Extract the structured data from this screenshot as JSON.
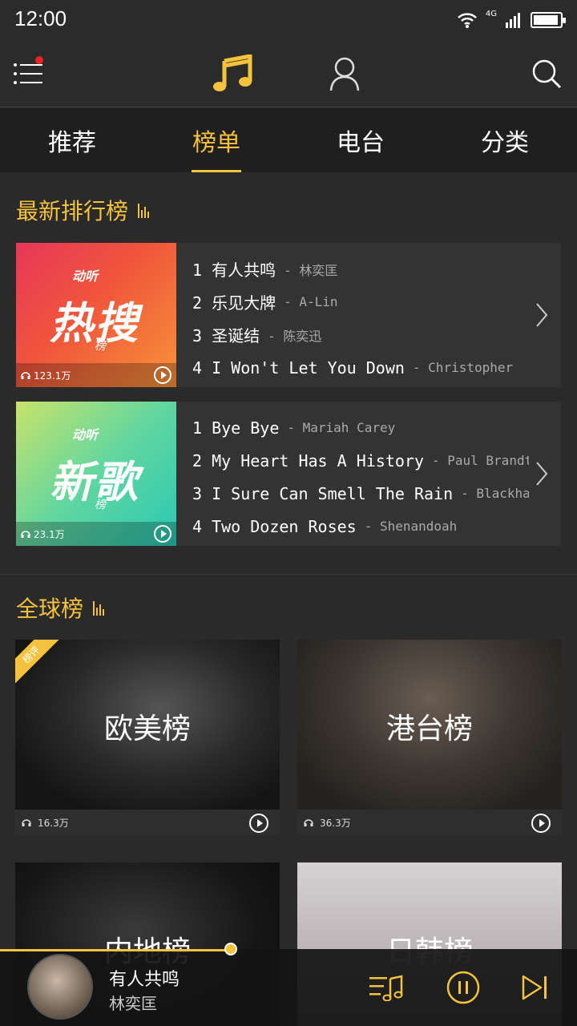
{
  "status": {
    "time": "12:00",
    "network": "4G"
  },
  "top_nav": {
    "menu_icon": "menu-icon",
    "music_icon": "music-note-icon",
    "user_icon": "user-icon",
    "search_icon": "search-icon",
    "accent": "#f5c33b"
  },
  "tabs": [
    {
      "label": "推荐",
      "active": false
    },
    {
      "label": "榜单",
      "active": true
    },
    {
      "label": "电台",
      "active": false
    },
    {
      "label": "分类",
      "active": false
    }
  ],
  "latest": {
    "title": "最新排行榜",
    "charts": [
      {
        "cover_small": "动听",
        "cover_big": "热搜",
        "cover_sub": "榜",
        "plays": "123.1万",
        "songs": [
          {
            "song": "1 有人共鸣",
            "artist": "- 林奕匡"
          },
          {
            "song": "2 乐见大牌",
            "artist": "- A-Lin"
          },
          {
            "song": "3 圣诞结",
            "artist": "- 陈奕迅"
          },
          {
            "song": "4 I Won't Let You Down",
            "artist": "- Christopher"
          }
        ]
      },
      {
        "cover_small": "动听",
        "cover_big": "新歌",
        "cover_sub": "榜",
        "plays": "23.1万",
        "songs": [
          {
            "song": "1 Bye Bye",
            "artist": "- Mariah Carey"
          },
          {
            "song": "2 My Heart Has A History",
            "artist": "- Paul Brandt"
          },
          {
            "song": "3 I Sure Can Smell The Rain",
            "artist": "- Blackhawk"
          },
          {
            "song": "4 Two Dozen Roses",
            "artist": "- Shenandoah"
          }
        ]
      }
    ]
  },
  "global": {
    "title": "全球榜",
    "charts": [
      {
        "label": "欧美榜",
        "plays": "16.3万",
        "ribbon": "榜评"
      },
      {
        "label": "港台榜",
        "plays": "36.3万"
      },
      {
        "label": "内地榜"
      },
      {
        "label": "日韩榜"
      }
    ]
  },
  "player": {
    "title": "有人共鸣",
    "artist": "林奕匡",
    "progress": 0.4,
    "icons": [
      "playlist-icon",
      "pause-icon",
      "next-icon"
    ]
  }
}
